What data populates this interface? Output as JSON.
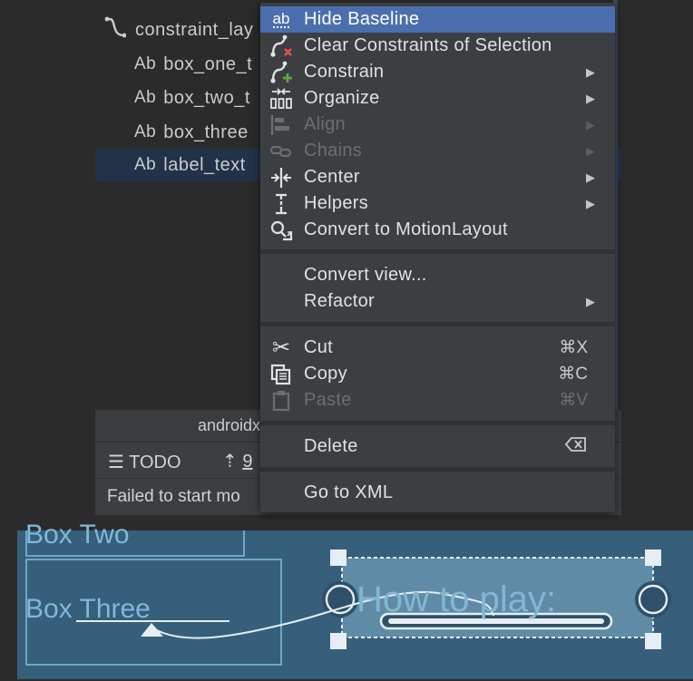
{
  "component_tree": {
    "items": [
      {
        "icon": "constraint-layout-icon",
        "label": "constraint_lay"
      },
      {
        "icon": "text-view-icon",
        "prefix": "Ab",
        "label": "box_one_t"
      },
      {
        "icon": "text-view-icon",
        "prefix": "Ab",
        "label": "box_two_t"
      },
      {
        "icon": "text-view-icon",
        "prefix": "Ab",
        "label": "box_three"
      },
      {
        "icon": "text-view-icon",
        "prefix": "Ab",
        "label": "label_text",
        "selected": true
      }
    ],
    "bottom_label": "androidx"
  },
  "bottom_toolbar": {
    "todo_label": "TODO",
    "vcs_label": "9"
  },
  "status_bar": {
    "message": "Failed to start mo"
  },
  "context_menu": {
    "groups": [
      [
        {
          "icon": "baseline-icon",
          "label": "Hide Baseline",
          "active": true
        },
        {
          "icon": "clear-constraints-icon",
          "label": "Clear Constraints of Selection"
        },
        {
          "icon": "constrain-icon",
          "label": "Constrain",
          "submenu": true
        },
        {
          "icon": "organize-icon",
          "label": "Organize",
          "submenu": true
        },
        {
          "icon": "align-icon",
          "label": "Align",
          "submenu": true,
          "disabled": true
        },
        {
          "icon": "chains-icon",
          "label": "Chains",
          "submenu": true,
          "disabled": true
        },
        {
          "icon": "center-icon",
          "label": "Center",
          "submenu": true
        },
        {
          "icon": "helpers-icon",
          "label": "Helpers",
          "submenu": true
        },
        {
          "icon": "motion-layout-icon",
          "label": "Convert to MotionLayout"
        }
      ],
      [
        {
          "label": "Convert view..."
        },
        {
          "label": "Refactor",
          "submenu": true
        }
      ],
      [
        {
          "icon": "cut-icon",
          "label": "Cut",
          "shortcut": "⌘X"
        },
        {
          "icon": "copy-icon",
          "label": "Copy",
          "shortcut": "⌘C"
        },
        {
          "icon": "paste-icon",
          "label": "Paste",
          "shortcut": "⌘V",
          "disabled": true
        }
      ],
      [
        {
          "label": "Delete",
          "shortcut_icon": "delete-key-icon"
        }
      ],
      [
        {
          "label": "Go to XML"
        }
      ]
    ],
    "baseline_icon_text": "ab",
    "submenu_arrow": "▶"
  },
  "layout_preview": {
    "boxes": [
      "Box Two",
      "Box Three"
    ],
    "selected_text": "How to play:"
  },
  "colors": {
    "menu_active": "#4b6eaf",
    "selection_row": "#223349",
    "canvas_bg": "#355f7a"
  }
}
